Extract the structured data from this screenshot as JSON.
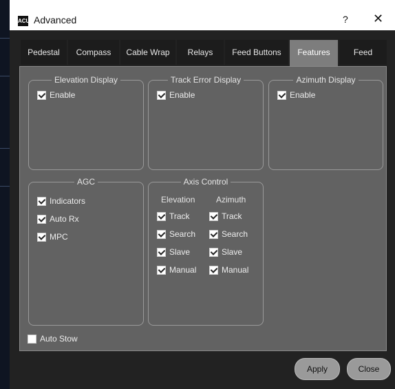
{
  "window": {
    "title": "Advanced",
    "help_glyph": "?",
    "close_glyph": "✕",
    "icon_text": "ACU"
  },
  "tabs": [
    "Pedestal",
    "Compass",
    "Cable Wrap",
    "Relays",
    "Feed Buttons",
    "Features",
    "Feed"
  ],
  "active_tab": "Features",
  "groups": {
    "elevation_display": {
      "title": "Elevation Display",
      "enable": "Enable"
    },
    "track_error_display": {
      "title": "Track Error Display",
      "enable": "Enable"
    },
    "azimuth_display": {
      "title": "Azimuth Display",
      "enable": "Enable"
    },
    "agc": {
      "title": "AGC",
      "items": [
        "Indicators",
        "Auto Rx",
        "MPC"
      ]
    },
    "axis_control": {
      "title": "Axis Control",
      "elevation_label": "Elevation",
      "azimuth_label": "Azimuth",
      "elevation_items": [
        "Track",
        "Search",
        "Slave",
        "Manual"
      ],
      "azimuth_items": [
        "Track",
        "Search",
        "Slave",
        "Manual"
      ]
    }
  },
  "auto_stow": {
    "label": "Auto Stow",
    "checked": false
  },
  "buttons": {
    "apply": "Apply",
    "close": "Close"
  }
}
